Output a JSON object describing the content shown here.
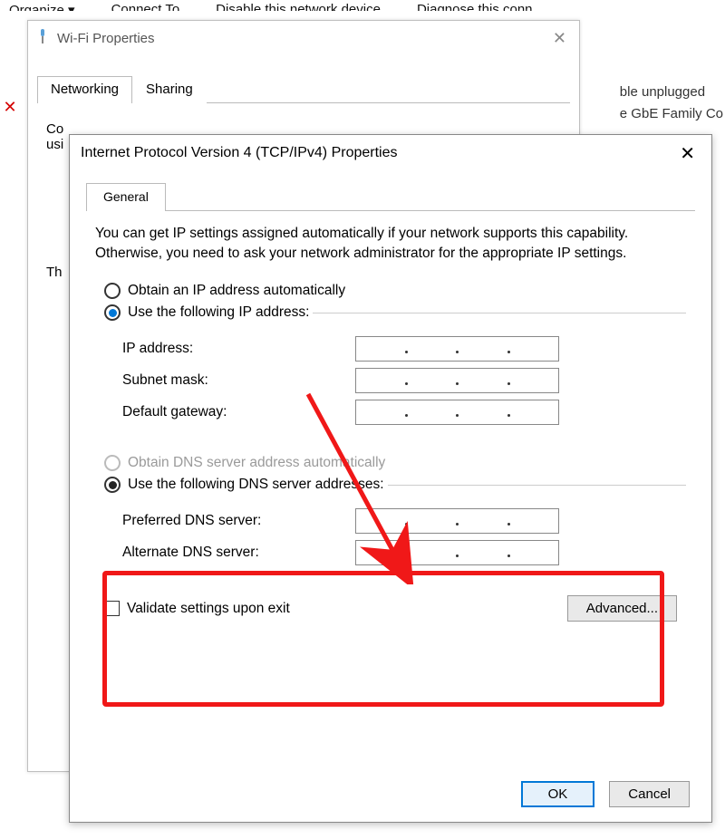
{
  "toolbar": {
    "organize": "Organize ▾",
    "connect": "Connect To",
    "disable": "Disable this network device",
    "diagnose": "Diagnose this conn"
  },
  "bg_right": {
    "line1": "ble unplugged",
    "line2": "e GbE Family Co"
  },
  "wifi": {
    "title": "Wi-Fi Properties",
    "tabs": {
      "networking": "Networking",
      "sharing": "Sharing"
    },
    "connect_using": "Connect using:",
    "th": "Th"
  },
  "ipv4": {
    "title": "Internet Protocol Version 4 (TCP/IPv4) Properties",
    "tab_general": "General",
    "help_text": "You can get IP settings assigned automatically if your network supports this capability. Otherwise, you need to ask your network administrator for the appropriate IP settings.",
    "radio_obtain_ip": "Obtain an IP address automatically",
    "radio_use_ip": "Use the following IP address:",
    "ip_address": "IP address:",
    "subnet": "Subnet mask:",
    "gateway": "Default gateway:",
    "radio_obtain_dns": "Obtain DNS server address automatically",
    "radio_use_dns": "Use the following DNS server addresses:",
    "pref_dns": "Preferred DNS server:",
    "alt_dns": "Alternate DNS server:",
    "validate": "Validate settings upon exit",
    "advanced": "Advanced...",
    "ok": "OK",
    "cancel": "Cancel"
  }
}
